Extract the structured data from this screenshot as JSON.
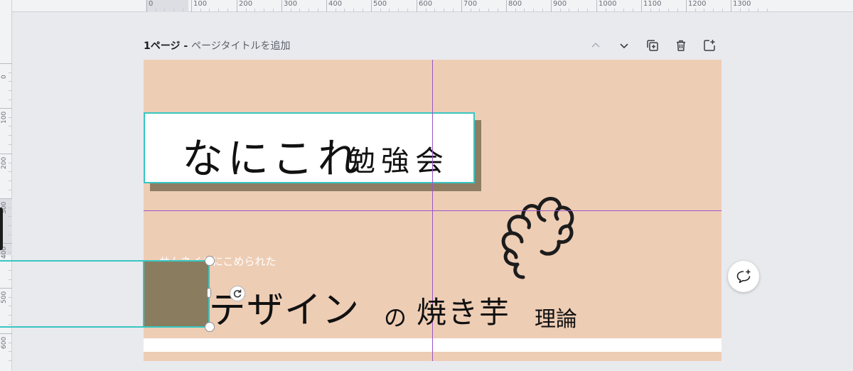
{
  "ruler": {
    "top_labels": [
      "0",
      "100",
      "200",
      "300",
      "400",
      "500",
      "600",
      "700",
      "800",
      "900",
      "1000",
      "1100",
      "1200",
      "1300"
    ],
    "left_labels": [
      "0",
      "100",
      "200",
      "300",
      "400",
      "500",
      "600"
    ]
  },
  "page_header": {
    "page_number": "1ページ",
    "separator": " - ",
    "add_title": "ページタイトルを追加"
  },
  "page_actions": {
    "icons": [
      "chevron-up-icon",
      "chevron-down-icon",
      "duplicate-page-icon",
      "trash-icon",
      "add-page-icon"
    ]
  },
  "canvas": {
    "background": "#eecdb5",
    "title_main": "なにこれ",
    "title_sub": "勉強会",
    "thumbnail_text": "サムネイルにこめられた",
    "design": "デザイン",
    "no": "の",
    "yakiimo": "焼き芋",
    "riron": "理論"
  },
  "colors": {
    "accent_teal": "#36c6c2",
    "guide_purple": "#9b55c7",
    "olive": "#8a7d5f",
    "shadow_brown": "#8e7d62"
  }
}
